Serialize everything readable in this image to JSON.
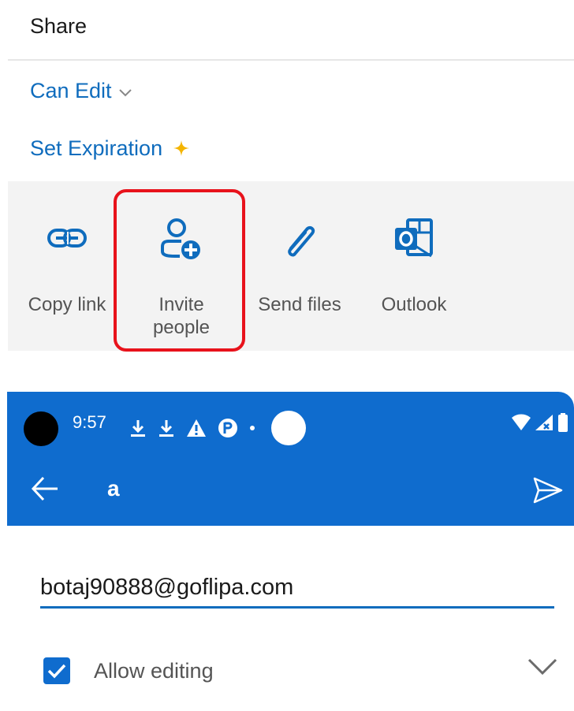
{
  "share_sheet": {
    "title": "Share",
    "permission_label": "Can Edit",
    "expiration_label": "Set Expiration",
    "options": [
      {
        "label": "Copy link",
        "icon": "link-icon"
      },
      {
        "label": "Invite people",
        "icon": "person-add-icon"
      },
      {
        "label": "Send files",
        "icon": "paperclip-icon"
      },
      {
        "label": "Outlook",
        "icon": "outlook-icon"
      }
    ],
    "colors": {
      "accent": "#0f6cbd",
      "highlight": "#e8121b",
      "sparkle": "#f4b400"
    }
  },
  "status_bar": {
    "time": "9:57"
  },
  "app_bar": {
    "title": "a",
    "background": "#0f6cce"
  },
  "invite_form": {
    "email_value": "botaj90888@goflipa.com",
    "allow_editing_label": "Allow editing",
    "allow_editing_checked": true
  }
}
